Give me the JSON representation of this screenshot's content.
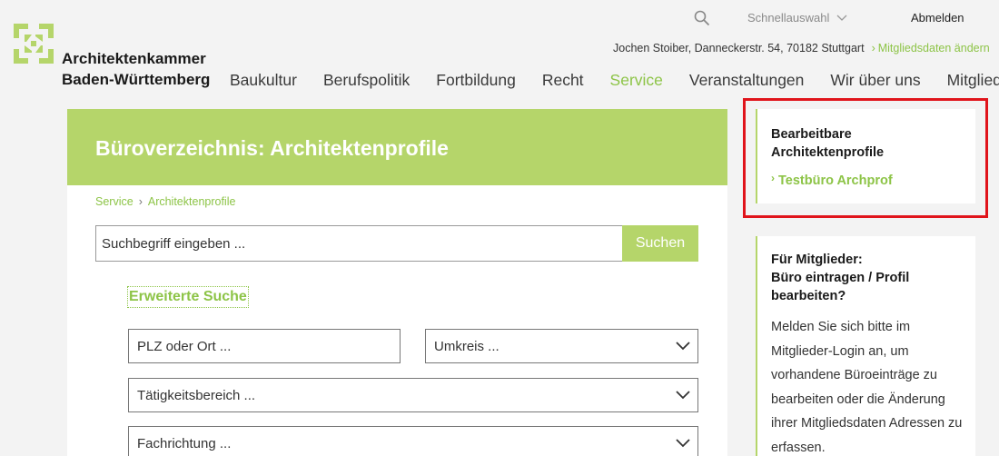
{
  "header": {
    "brand_line1": "Architektenkammer",
    "brand_line2": "Baden-Württemberg",
    "quick_select": "Schnellauswahl",
    "logout": "Abmelden",
    "member_text": "Jochen Stoiber, Danneckerstr. 54, 70182 Stuttgart",
    "member_link": "Mitgliedsdaten ändern",
    "nav": [
      "Baukultur",
      "Berufspolitik",
      "Fortbildung",
      "Recht",
      "Service",
      "Veranstaltungen",
      "Wir über uns",
      "Mitgliedschaft"
    ],
    "active_nav": "Service"
  },
  "main": {
    "title": "Büroverzeichnis: Architektenprofile",
    "breadcrumb": [
      "Service",
      "Architektenprofile"
    ],
    "search_placeholder": "Suchbegriff eingeben ...",
    "search_button": "Suchen",
    "advanced": "Erweiterte Suche",
    "location_placeholder": "PLZ oder Ort ...",
    "radius": "Umkreis ...",
    "activity": "Tätigkeitsbereich ...",
    "discipline": "Fachrichtung ..."
  },
  "sidebar": {
    "editable_title_1": "Bearbeitbare",
    "editable_title_2": "Architektenprofile",
    "editable_link": "Testbüro Archprof",
    "members_title_1": "Für Mitglieder:",
    "members_title_2": "Büro eintragen / Profil",
    "members_title_3": "bearbeiten?",
    "members_text": "Melden Sie sich bitte im Mitglieder-Login an, um vorhandene Büroeinträge zu bearbeiten oder die Änderung ihrer Mitgliedsdaten Adressen zu erfassen."
  },
  "colors": {
    "accent": "#8dc447",
    "banner": "#b5d56a",
    "highlight": "#e0141b"
  }
}
